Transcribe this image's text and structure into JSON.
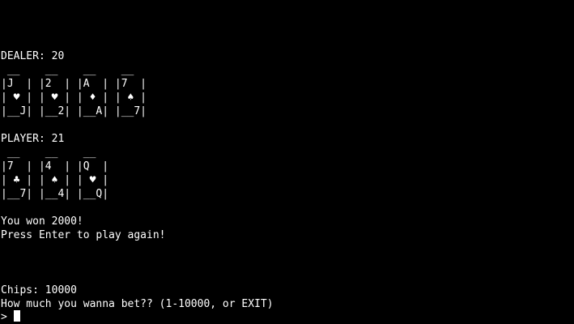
{
  "dealer": {
    "label": "DEALER: 20",
    "cards_top": " __    __    __    __",
    "cards_rank": "|J  | |2  | |A  | |7  |",
    "cards_suit": "| ♥ | | ♥ | | ♦ | | ♠ |",
    "cards_bottom": "|__J| |__2| |__A| |__7|"
  },
  "player": {
    "label": "PLAYER: 21",
    "cards_top": " __    __    __",
    "cards_rank": "|7  | |4  | |Q  |",
    "cards_suit": "| ♣ | | ♠ | | ♥ |",
    "cards_bottom": "|__7| |__4| |__Q|"
  },
  "result": {
    "message": "You won 2000!",
    "prompt": "Press Enter to play again!"
  },
  "status": {
    "chips": "Chips: 10000",
    "bet_prompt": "How much you wanna bet?? (1-10000, or EXIT)"
  },
  "input": {
    "prompt_symbol": ">",
    "value": ""
  },
  "colors": {
    "background": "#000000",
    "foreground": "#ffffff"
  }
}
